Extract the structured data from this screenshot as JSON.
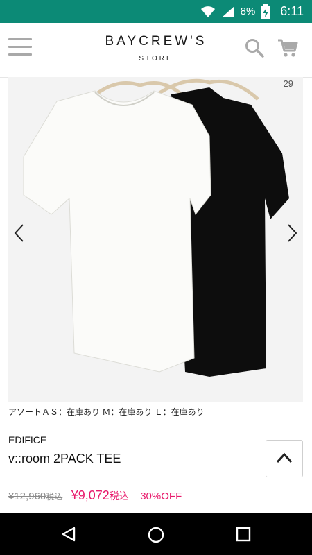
{
  "status_bar": {
    "battery_percent": "8%",
    "time": "6:11",
    "bg_color": "#0c8a76"
  },
  "header": {
    "brand_name": "BAYCREW'S",
    "brand_sub": "STORE"
  },
  "gallery": {
    "counter_visible": "29"
  },
  "product": {
    "stock_status": "アソートＡＳ：在庫あり Ｍ：在庫あり Ｌ：在庫あり",
    "brand": "EDIFICE",
    "name": "v::room 2PACK TEE",
    "original_price": "¥12,960",
    "original_tax": "税込",
    "sale_price": "¥9,072",
    "sale_tax": "税込",
    "discount": "30%OFF",
    "accent_color": "#e8196b"
  },
  "icons": {
    "menu": "hamburger-menu-icon",
    "search": "search-icon",
    "cart": "cart-icon",
    "prev": "chevron-left-icon",
    "next": "chevron-right-icon",
    "scroll_top": "chevron-up-icon",
    "back": "back-triangle-icon",
    "home": "home-circle-icon",
    "recents": "recents-square-icon"
  }
}
